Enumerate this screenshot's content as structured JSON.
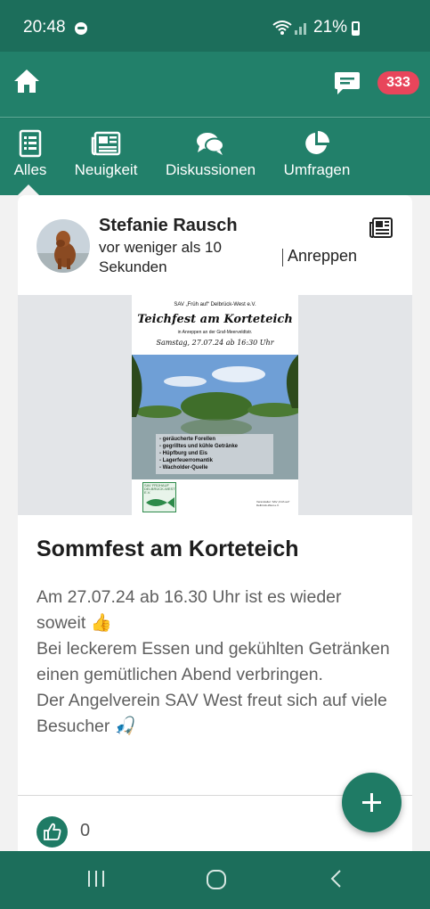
{
  "status_bar": {
    "time": "20:48",
    "battery": "21%"
  },
  "app_bar": {
    "notification_count": "333"
  },
  "tabs": [
    {
      "label": "Alles",
      "icon": "list-icon",
      "active": true
    },
    {
      "label": "Neuigkeit",
      "icon": "newspaper-icon",
      "active": false
    },
    {
      "label": "Diskussionen",
      "icon": "chat-bubbles-icon",
      "active": false
    },
    {
      "label": "Umfragen",
      "icon": "pie-chart-icon",
      "active": false
    }
  ],
  "post": {
    "author": "Stefanie Rausch",
    "time": "vor weniger als 10 Sekunden",
    "location": "Anreppen",
    "type_icon": "newspaper-icon",
    "poster": {
      "club": "SAV „Früh auf“ Delbrück-West e.V.",
      "title": "Teichfest am Korteteich",
      "subtitle": "in Anreppen an der Graf-Meerveldtstr.",
      "date": "Samstag, 27.07.24 ab 16:30 Uhr",
      "items": [
        "- geräucherte Forellen",
        "- gegrilltes und kühle Getränke",
        "- Hüpfburg und Eis",
        "- Lagerfeuerromantik",
        "- Wacholder-Quelle"
      ],
      "logo_text": "SAV FRÜHAUF DELBRÜCK-WEST E.V.",
      "signature": "Veranstalter: SAV „Früh auf“ Delbrück-West e.V."
    },
    "title": "Sommfest am Korteteich",
    "body_lines": [
      "Am 27.07.24 ab 16.30 Uhr ist es wieder soweit 👍",
      "Bei leckerem Essen und gekühlten Getränken einen gemütlichen Abend verbringen.",
      "Der Angelverein SAV West freut sich auf viele Besucher 🎣"
    ],
    "like_count": "0"
  },
  "colors": {
    "primary": "#22806a",
    "primary_dark": "#1c6e5b",
    "badge": "#e8455b",
    "background": "#f2f2f2"
  }
}
